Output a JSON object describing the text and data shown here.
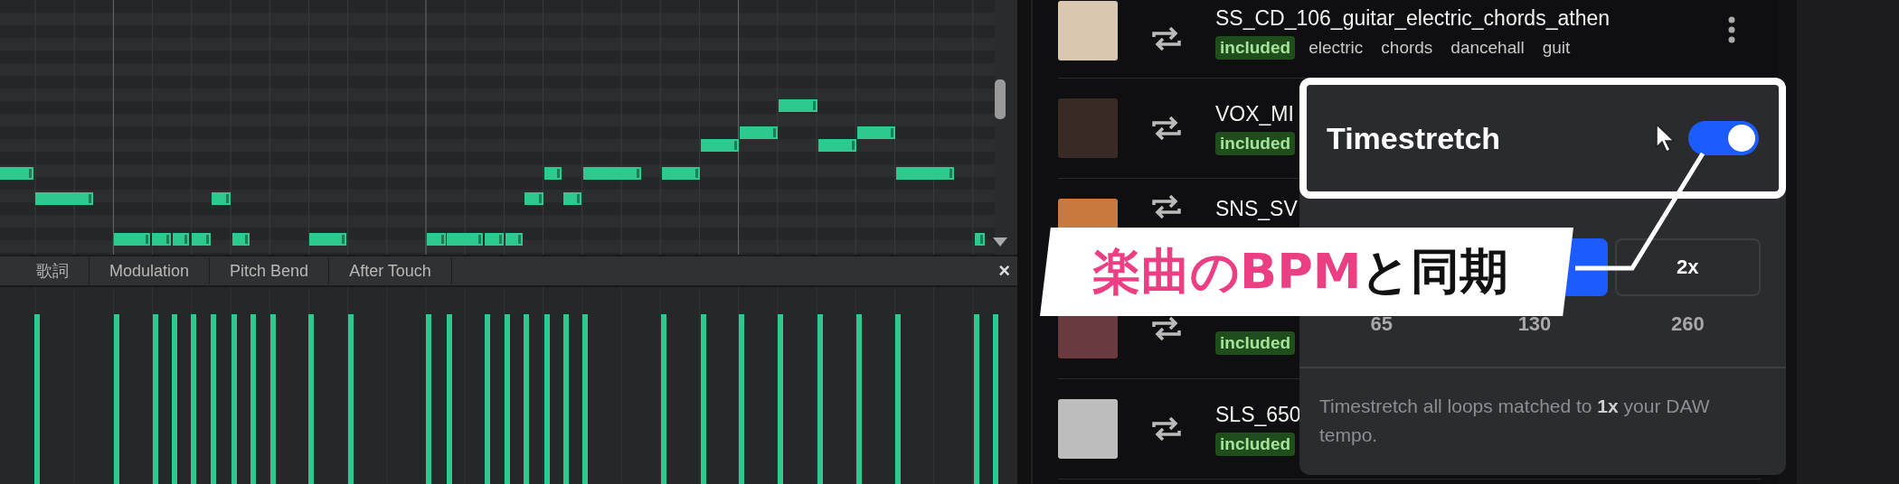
{
  "piano_roll": {
    "lane_tabs": [
      {
        "label": "歌詞"
      },
      {
        "label": "Modulation"
      },
      {
        "label": "Pitch Bend"
      },
      {
        "label": "After Touch"
      }
    ],
    "close": "×"
  },
  "loops": [
    {
      "title": "SS_CD_106_guitar_electric_chords_athen",
      "has_menu": true,
      "tags": [
        {
          "text": "included",
          "kind": "license"
        },
        {
          "text": "electric",
          "kind": "genre"
        },
        {
          "text": "chords",
          "kind": "genre"
        },
        {
          "text": "dancehall",
          "kind": "genre"
        },
        {
          "text": "guit",
          "kind": "genre"
        }
      ]
    },
    {
      "title": "VOX_MI",
      "has_menu": false,
      "tags": [
        {
          "text": "included",
          "kind": "license"
        }
      ]
    },
    {
      "title": "SNS_SV",
      "has_menu": false
    },
    {
      "has_menu": false,
      "tags": [
        {
          "text": "included",
          "kind": "license"
        }
      ]
    },
    {
      "title": "SLS_650",
      "has_menu": false,
      "tags": [
        {
          "text": "included",
          "kind": "license"
        }
      ]
    }
  ],
  "timestretch": {
    "title": "Timestretch",
    "on": true,
    "rate_buttons": [
      {
        "selected": true
      },
      {
        "label": "2x",
        "selected": false
      }
    ],
    "bpms": [
      "65",
      "130",
      "260"
    ],
    "description": "Timestretch all loops matched to **1x** your DAW tempo."
  },
  "caption": {
    "highlight": "楽曲のBPM",
    "rest": "と同期"
  }
}
